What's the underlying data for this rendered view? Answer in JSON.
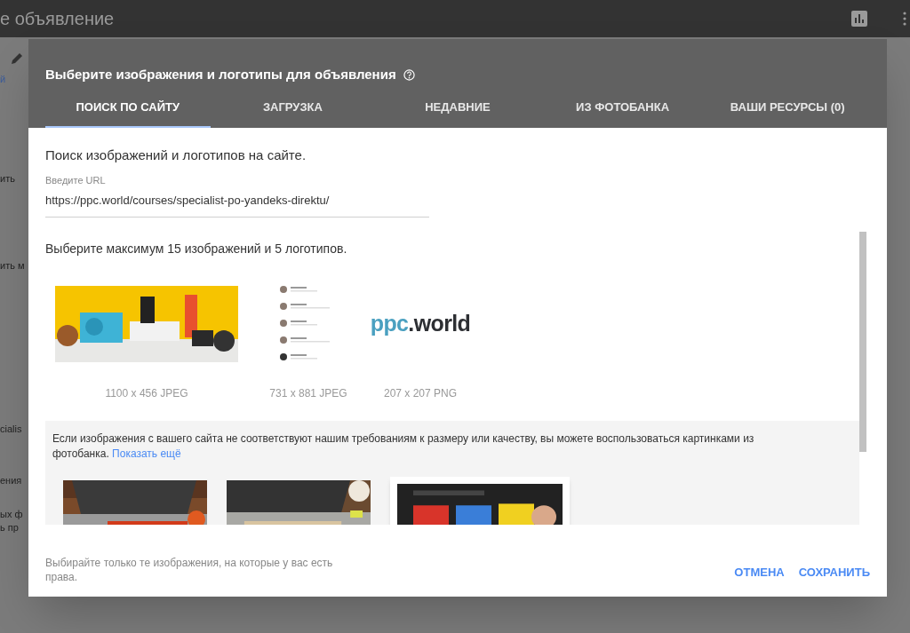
{
  "backdrop": {
    "title": "е объявление",
    "side_texts": [
      "й",
      "ить",
      "ить м",
      "cialis",
      "ения",
      "ых ф",
      "ь пр"
    ]
  },
  "dialog": {
    "title": "Выберите изображения и логотипы для объявления",
    "tabs": [
      {
        "label": "ПОИСК ПО САЙТУ",
        "selected": true
      },
      {
        "label": "ЗАГРУЗКА",
        "selected": false
      },
      {
        "label": "НЕДАВНИЕ",
        "selected": false
      },
      {
        "label": "ИЗ ФОТОБАНКА",
        "selected": false
      },
      {
        "label": "ВАШИ РЕСУРСЫ (0)",
        "selected": false
      }
    ],
    "intro": "Поиск изображений и логотипов на сайте.",
    "url_field": {
      "label": "Введите URL",
      "value": "https://ppc.world/courses/specialist-po-yandeks-direktu/"
    },
    "limit_text": "Выберите максимум 15 изображений и 5 логотипов.",
    "site_images": [
      {
        "kind": "picture",
        "caption": "1100 x 456 JPEG"
      },
      {
        "kind": "list",
        "caption": "731 x 881 JPEG"
      },
      {
        "kind": "logo",
        "logo_parts": [
          "ppc",
          ".world"
        ],
        "caption": "207 x 207 PNG"
      }
    ],
    "stock_note": {
      "text": "Если изображения с вашего сайта не соответствуют нашим требованиям к размеру или качеству, вы можете воспользоваться картинками из фотобанка.",
      "link": "Показать ещё"
    },
    "stock_images": [
      {
        "selected": false
      },
      {
        "selected": false
      },
      {
        "selected": true
      }
    ],
    "footer_note": "Выбирайте только те изображения, на которые у вас есть права.",
    "buttons": [
      "ОТМЕНА",
      "СОХРАНИТЬ"
    ]
  }
}
